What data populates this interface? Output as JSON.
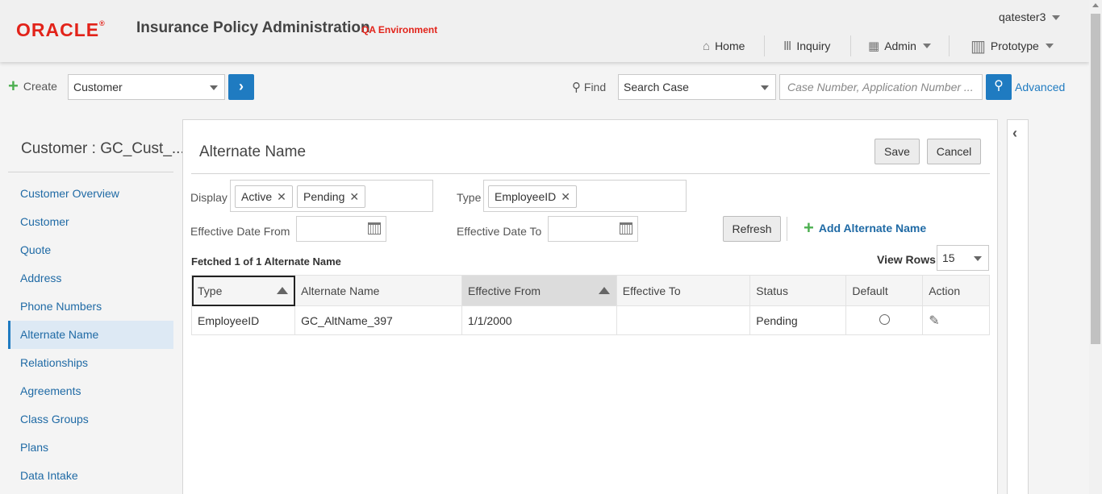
{
  "header": {
    "logo": "ORACLE",
    "app_title": "Insurance Policy Administration",
    "environment": "QA Environment",
    "user": "qatester3",
    "nav": [
      {
        "label": "Home",
        "icon": "home-icon"
      },
      {
        "label": "Inquiry",
        "icon": "library-icon"
      },
      {
        "label": "Admin",
        "icon": "grid-icon"
      },
      {
        "label": "Prototype",
        "icon": "building-icon"
      }
    ]
  },
  "toolbar": {
    "create_label": "Create",
    "create_select": "Customer",
    "find_label": "Find",
    "find_select": "Search Case",
    "search_placeholder": "Case Number,  Application Number ...",
    "advanced_label": "Advanced"
  },
  "sidebar": {
    "title": "Customer : GC_Cust_...",
    "items": [
      {
        "label": "Customer Overview"
      },
      {
        "label": "Customer"
      },
      {
        "label": "Quote"
      },
      {
        "label": "Address"
      },
      {
        "label": "Phone Numbers"
      },
      {
        "label": "Alternate Name",
        "active": true
      },
      {
        "label": "Relationships"
      },
      {
        "label": "Agreements"
      },
      {
        "label": "Class Groups"
      },
      {
        "label": "Plans"
      },
      {
        "label": "Data Intake"
      }
    ]
  },
  "main": {
    "title": "Alternate Name",
    "save_label": "Save",
    "cancel_label": "Cancel",
    "display_label": "Display",
    "display_tags": [
      "Active",
      "Pending"
    ],
    "type_label": "Type",
    "type_tags": [
      "EmployeeID"
    ],
    "eff_from_label": "Effective Date From",
    "eff_to_label": "Effective Date To",
    "refresh_label": "Refresh",
    "add_label": "Add Alternate Name",
    "fetched_text": "Fetched 1 of 1 Alternate Name",
    "view_rows_label": "View Rows",
    "view_rows_value": "15"
  },
  "table": {
    "columns": [
      "Type",
      "Alternate Name",
      "Effective From",
      "Effective To",
      "Status",
      "Default",
      "Action"
    ],
    "rows": [
      {
        "type": "EmployeeID",
        "alternate_name": "GC_AltName_397",
        "effective_from": "1/1/2000",
        "effective_to": "",
        "status": "Pending"
      }
    ]
  },
  "colors": {
    "brand_red": "#e2231a",
    "accent_blue": "#1f7bc1",
    "link_blue": "#1f6aa5",
    "add_green": "#4caf50"
  }
}
